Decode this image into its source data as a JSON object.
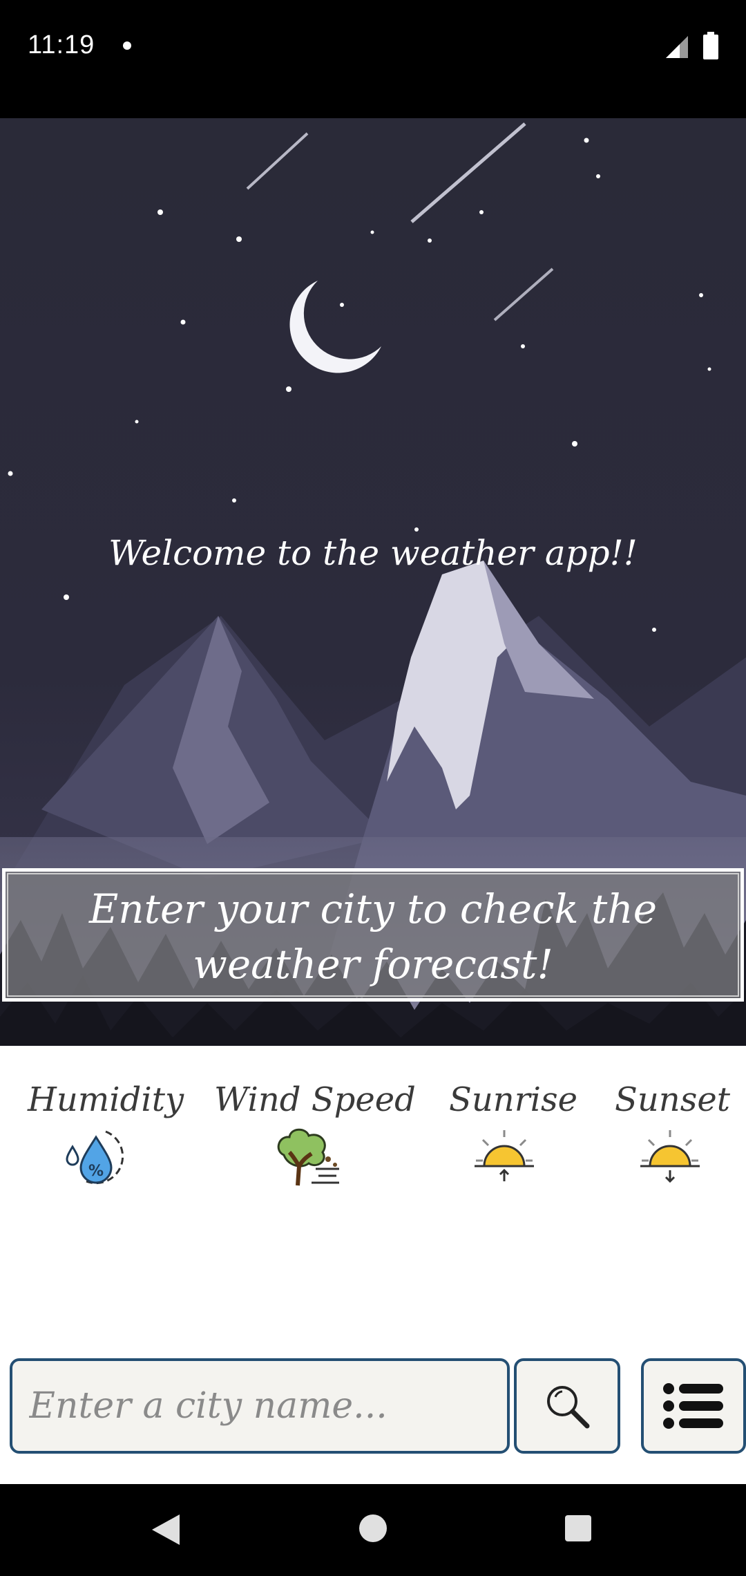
{
  "status_bar": {
    "time": "11:19"
  },
  "hero": {
    "welcome_text": "Welcome to the weather app!!",
    "prompt_text": "Enter your city to check the weather forecast!"
  },
  "info_row": [
    {
      "label": "Humidity",
      "icon": "humidity-icon"
    },
    {
      "label": "Wind Speed",
      "icon": "wind-tree-icon"
    },
    {
      "label": "Sunrise",
      "icon": "sunrise-icon"
    },
    {
      "label": "Sunset",
      "icon": "sunset-icon"
    }
  ],
  "search": {
    "placeholder": "Enter a city name...",
    "value": ""
  },
  "colors": {
    "accent_border": "#244f73",
    "sky": "#2b2a39",
    "sun": "#f6c531"
  }
}
